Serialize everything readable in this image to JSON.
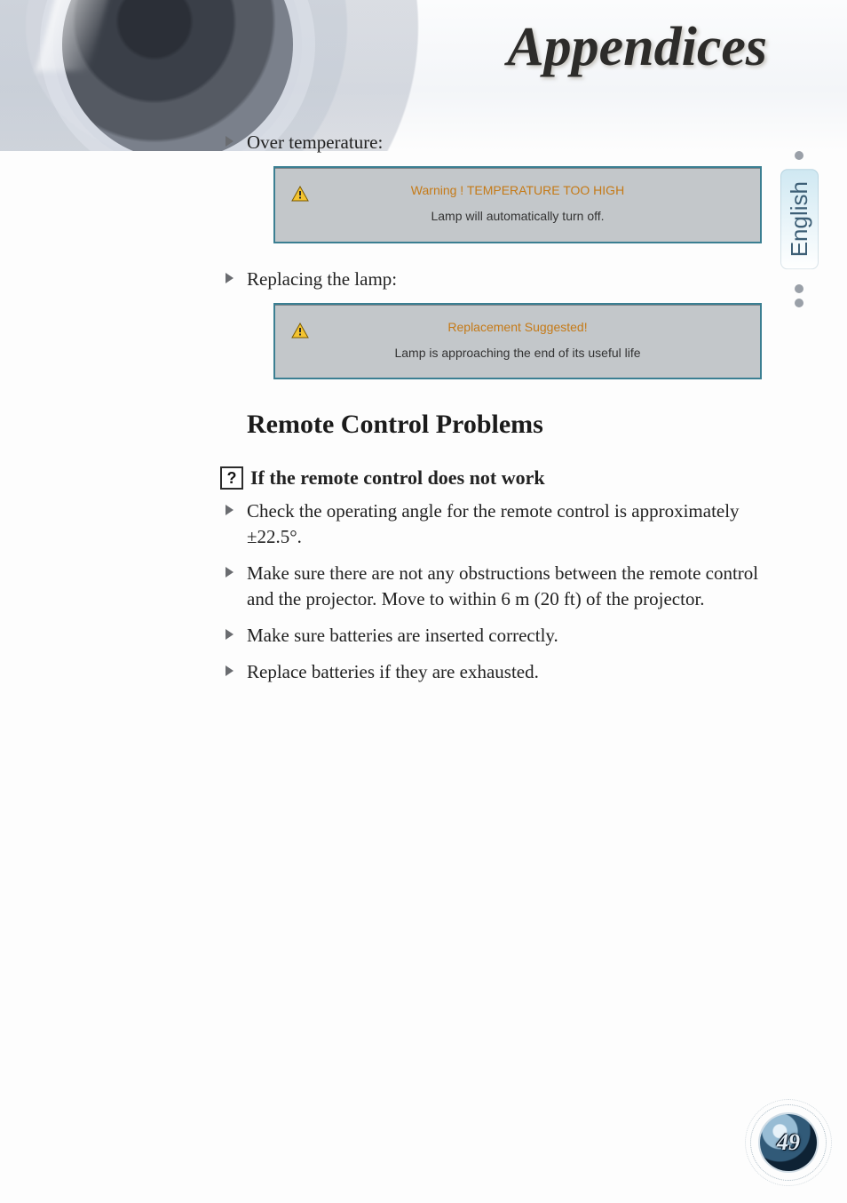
{
  "chapter_title": "Appendices",
  "language_tab": "English",
  "page_number": "49",
  "bullets_top": [
    "Over temperature:",
    "Replacing the lamp:"
  ],
  "dialogs": [
    {
      "line1": "Warning ! TEMPERATURE TOO HIGH",
      "line2": "Lamp will automatically turn off."
    },
    {
      "line1": "Replacement Suggested!",
      "line2": "Lamp is approaching the end of its useful life"
    }
  ],
  "section_heading": "Remote Control Problems",
  "question_heading": "If the remote control does not work",
  "remote_bullets": [
    "Check the operating angle for the remote control is approximately ±22.5°.",
    "Make sure there are not any obstructions between the remote control and the projector. Move to within 6 m (20 ft) of the projector.",
    "Make sure batteries are inserted correctly.",
    "Replace batteries if they are exhausted."
  ]
}
